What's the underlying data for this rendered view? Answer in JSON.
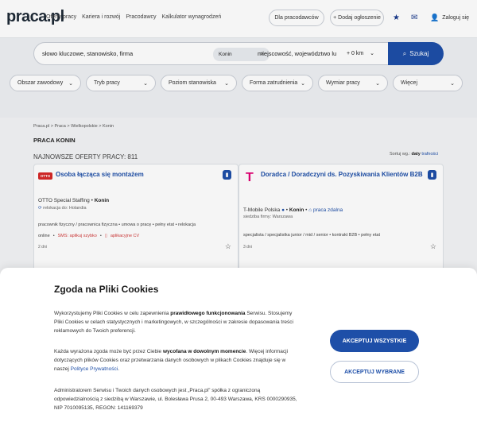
{
  "header": {
    "logo": "praca.pl",
    "nav": [
      "Oferty pracy",
      "Kariera i rozwój",
      "Pracodawcy",
      "Kalkulator wynagrodzeń"
    ],
    "for_employers": "Dla pracodawców",
    "add_offer": "+ Dodaj ogłoszenie",
    "login": "Zaloguj się"
  },
  "search": {
    "keywords_placeholder": "słowo kluczowe, stanowisko, firma",
    "location_chip": "Konin",
    "location_placeholder": "miejscowość, województwo lu",
    "distance": "+ 0 km",
    "button": "Szukaj"
  },
  "filters": [
    "Obszar zawodowy",
    "Tryb pracy",
    "Poziom stanowiska",
    "Forma zatrudnienia",
    "Wymiar pracy",
    "Więcej"
  ],
  "breadcrumb": "Praca.pl  >  Praca  >  Wielkopolskie  >  Konin",
  "page_title": "PRACA KONIN",
  "newest": "NAJNOWSZE OFERTY PRACY: 811",
  "sort": {
    "label": "Sortuj wg.:",
    "active": "daty",
    "alt": "trafności"
  },
  "cards": [
    {
      "title": "Osoba łącząca się montażem",
      "company": "OTTO Special Staffing",
      "city": "Konin",
      "sub": "relokacja do: Holandia",
      "tags": "pracownik fizyczny / pracownica fizyczna  •  umowa o pracę  •  pełny etat  •  relokacja",
      "extra1": "online",
      "extra2": "SMS: aplikuj szybko",
      "extra3": "aplikacyjne CV",
      "ago": "2 dni"
    },
    {
      "title": "Doradca / Doradczyni ds. Pozyskiwania Klientów B2B",
      "company": "T-Mobile Polska",
      "city": "Konin",
      "remote": "praca zdalna",
      "sub": "siedziba firmy: Warszawa",
      "tags": "specjalista / specjalistka junior / mid / senior  •  kontrakt B2B  •  pełny etat",
      "ago": "3 dni"
    }
  ],
  "cookies": {
    "title": "Zgoda na Pliki Cookies",
    "p1_a": "Wykorzystujemy Pliki Cookies w celu zapewnienia ",
    "p1_b": "prawidłowego funkcjonowania",
    "p1_c": " Serwisu. Stosujemy Pliki Cookies w celach statystycznych i marketingowych, w szczególności w zakresie dopasowania treści reklamowych do Twoich preferencji.",
    "p2_a": "Każda wyrażona zgoda może być przez Ciebie ",
    "p2_b": "wycofana w dowolnym momencie",
    "p2_c": ". Więcej informacji dotyczących plików Cookies oraz przetwarzania danych osobowych w plikach Cookies znajduje się w naszej ",
    "p2_link": "Polityce Prywatności",
    "p2_d": ".",
    "p3": "Administratorem Serwisu i Twoich danych osobowych jest „Praca.pl” spółka z ograniczoną odpowiedzialnością z siedzibą w Warszawie, ul. Bolesława Prusa 2, 00-493 Warszawa, KRS 0000290935, NIP 7010095135, REGON: 141169379",
    "accept_all": "AKCEPTUJ WSZYSTKIE",
    "accept_selected": "AKCEPTUJ WYBRANE"
  }
}
